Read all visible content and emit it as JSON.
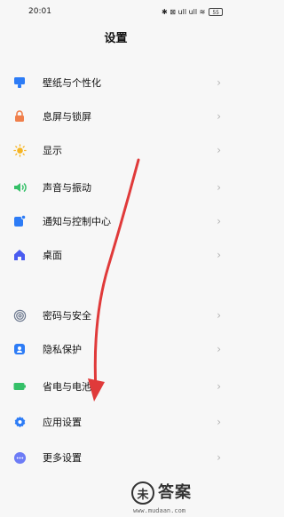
{
  "status_bar": {
    "time": "20:01",
    "icons_text": "✱ ⊠ ull ull ≋",
    "battery": "55"
  },
  "page_title": "设置",
  "items": [
    {
      "label": "壁纸与个性化",
      "icon": "wallpaper-icon",
      "color": "#2d7cf6"
    },
    {
      "label": "息屏与锁屏",
      "icon": "lock-icon",
      "color": "#f07f4b"
    },
    {
      "label": "显示",
      "icon": "sun-icon",
      "color": "#f6b420"
    },
    {
      "label": "声音与振动",
      "icon": "speaker-icon",
      "color": "#35c068"
    },
    {
      "label": "通知与控制中心",
      "icon": "notification-icon",
      "color": "#2d7cf6"
    },
    {
      "label": "桌面",
      "icon": "home-icon",
      "color": "#4a5cf0"
    },
    {
      "label": "密码与安全",
      "icon": "fingerprint-icon",
      "color": "#6e7a90"
    },
    {
      "label": "隐私保护",
      "icon": "privacy-icon",
      "color": "#2d7cf6"
    },
    {
      "label": "省电与电池",
      "icon": "battery-icon",
      "color": "#35c068"
    },
    {
      "label": "应用设置",
      "icon": "gear-icon",
      "color": "#2d7cf6"
    },
    {
      "label": "更多设置",
      "icon": "more-icon",
      "color": "#6d7cf6"
    }
  ],
  "chevron": "›",
  "watermark": {
    "symbol": "未",
    "text": "答案",
    "url": "www.mudaan.com"
  },
  "annotation_color": "#e03a3a"
}
